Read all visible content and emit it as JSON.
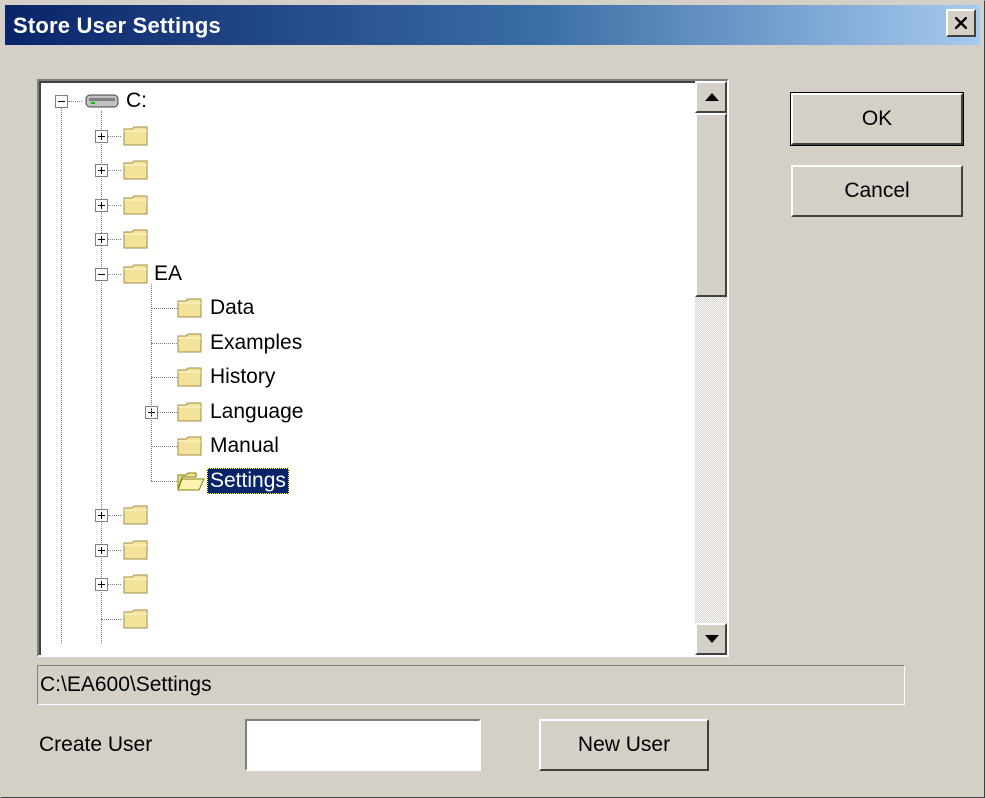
{
  "window": {
    "title": "Store User Settings",
    "close_symbol": "×"
  },
  "tree": {
    "root": {
      "label": "C:",
      "icon": "drive-icon",
      "expanded": true
    },
    "top_folders_before": 4,
    "ea_folder": {
      "label": "EA",
      "expanded": true,
      "children": [
        {
          "label": "Data",
          "expandable": false
        },
        {
          "label": "Examples",
          "expandable": false
        },
        {
          "label": "History",
          "expandable": false
        },
        {
          "label": "Language",
          "expandable": true
        },
        {
          "label": "Manual",
          "expandable": false
        },
        {
          "label": "Settings",
          "expandable": false,
          "selected": true
        }
      ]
    },
    "top_folders_after": 4
  },
  "buttons": {
    "ok": "OK",
    "cancel": "Cancel",
    "new_user": "New User"
  },
  "path_display": "C:\\EA600\\Settings",
  "create_user": {
    "label": "Create User",
    "value": ""
  },
  "colors": {
    "title_start": "#0a246a",
    "title_end": "#a6caf0",
    "face": "#d4d0c8",
    "selection": "#0a246a",
    "folder": "#f3e29a"
  }
}
